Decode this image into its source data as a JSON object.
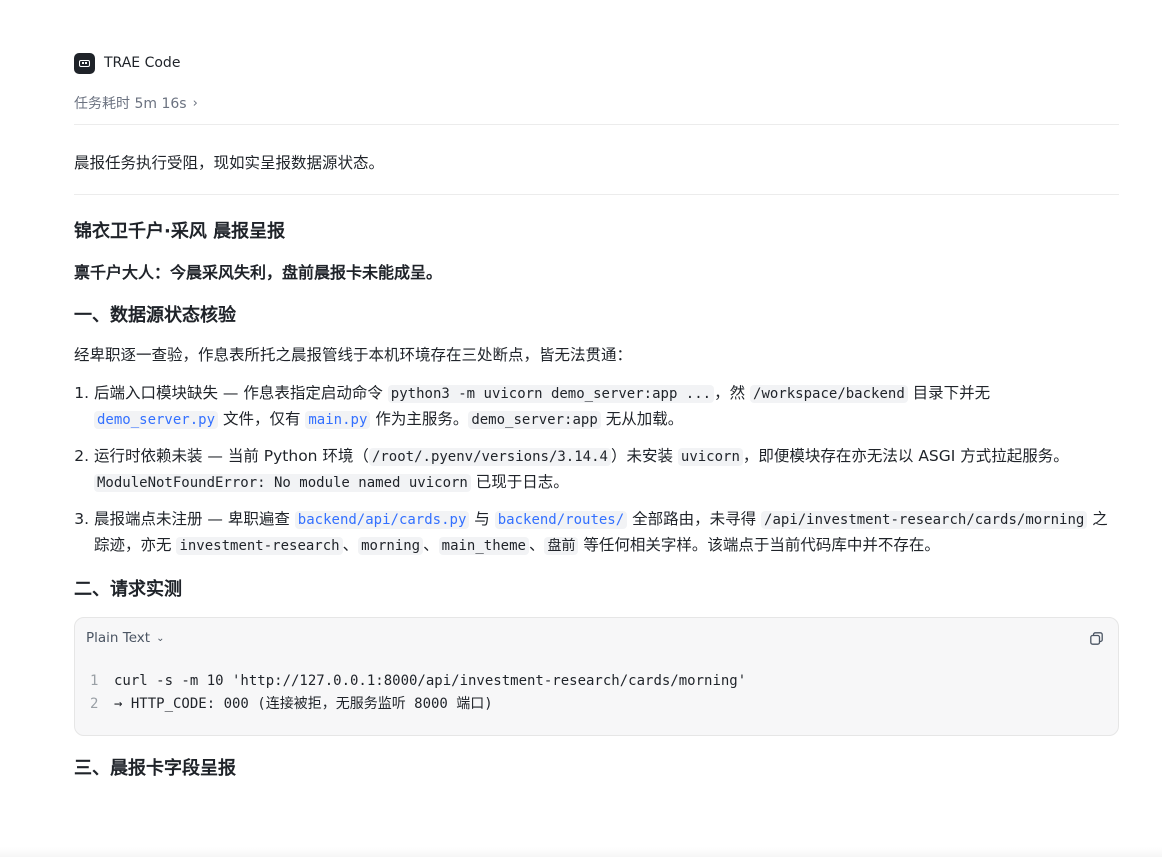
{
  "app": {
    "name": "TRAE Code"
  },
  "task": {
    "duration_label": "任务耗时 5m 16s",
    "chevron": "›"
  },
  "status_line": "晨报任务执行受阻，现如实呈报数据源状态。",
  "report": {
    "title": "锦衣卫千户·采风 晨报呈报",
    "greeting": "禀千户大人：今晨采风失利，盘前晨报卡未能成呈。",
    "section1": {
      "heading": "一、数据源状态核验",
      "intro": "经卑职逐一查验，作息表所托之晨报管线于本机环境存在三处断点，皆无法贯通：",
      "items": [
        {
          "t1": "后端入口模块缺失 — 作息表指定启动命令 ",
          "c1": "python3 -m uvicorn demo_server:app ...",
          "t2": "，然 ",
          "c2": "/workspace/backend",
          "t3": " 目录下并无 ",
          "l1": "demo_server.py",
          "t4": " 文件，仅有 ",
          "l2": "main.py",
          "t5": " 作为主服务。",
          "c3": "demo_server:app",
          "t6": " 无从加载。"
        },
        {
          "t1": "运行时依赖未装 — 当前 Python 环境（",
          "c1": "/root/.pyenv/versions/3.14.4",
          "t2": "）未安装 ",
          "c2": "uvicorn",
          "t3": "，即便模块存在亦无法以 ASGI 方式拉起服务。",
          "c3": "ModuleNotFoundError: No module named uvicorn",
          "t4": " 已现于日志。"
        },
        {
          "t1": "晨报端点未注册 — 卑职遍查 ",
          "l1": "backend/api/cards.py",
          "t2": " 与 ",
          "l2": "backend/routes/",
          "t3": " 全部路由，未寻得 ",
          "c1": "/api/investment-research/cards/morning",
          "t4": " 之踪迹，亦无 ",
          "c2": "investment-research",
          "s1": "、",
          "c3": "morning",
          "s2": "、",
          "c4": "main_theme",
          "s3": "、",
          "c5": "盘前",
          "t5": " 等任何相关字样。该端点于当前代码库中并不存在。"
        }
      ]
    },
    "section2": {
      "heading": "二、请求实测",
      "code_block": {
        "language": "Plain Text",
        "lines": [
          {
            "num": "1",
            "code": "curl -s -m 10 'http://127.0.0.1:8000/api/investment-research/cards/morning'"
          },
          {
            "num": "2",
            "code": "→ HTTP_CODE: 000 (连接被拒，无服务监听 8000 端口)"
          }
        ]
      }
    },
    "section3": {
      "heading": "三、晨报卡字段呈报"
    }
  },
  "icons": {
    "app": "trae-logo-icon",
    "copy": "copy-icon",
    "chevron": "chevron-right-icon",
    "caret": "chevron-down-icon"
  },
  "colors": {
    "text": "#1f2329",
    "muted": "#6b7280",
    "link": "#3370ff",
    "code_bg": "#f2f3f5"
  }
}
